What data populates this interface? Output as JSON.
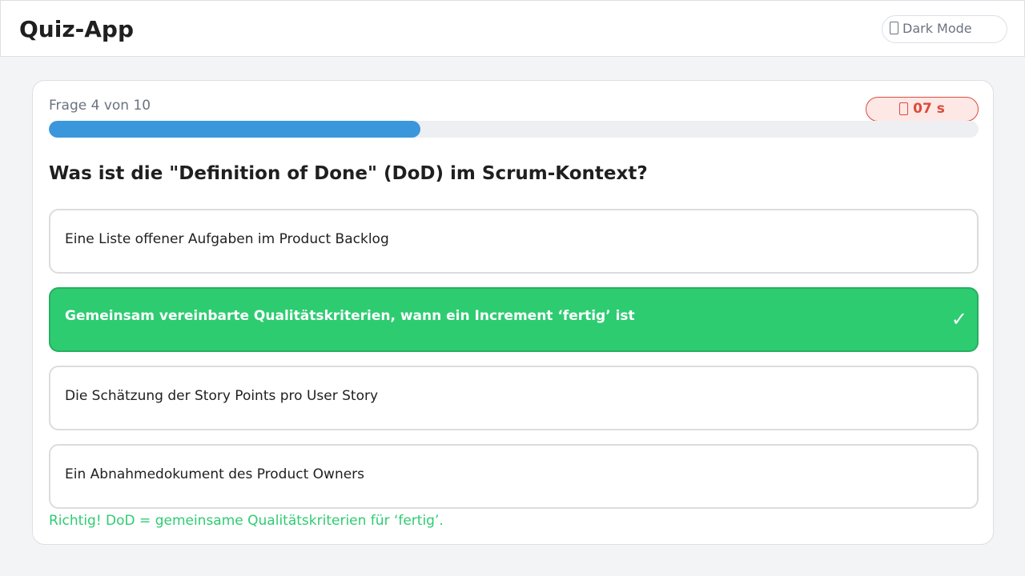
{
  "app": {
    "title": "Quiz-App"
  },
  "header": {
    "dark_mode_label": "Dark Mode",
    "dark_mode_icon": "moon-icon"
  },
  "quiz": {
    "progress_text": "Frage 4 von 10",
    "progress_fraction": 0.4,
    "timer_text": "07 s",
    "timer_icon": "stopwatch-icon",
    "question": "Was ist die \"Definition of Done\" (DoD) im Scrum-Kontext?",
    "answers": [
      {
        "text": "Eine Liste offener Aufgaben im Product Backlog",
        "state": "neutral"
      },
      {
        "text": "Gemeinsam vereinbarte Qualitätskriterien, wann ein Increment ‘fertig’ ist",
        "state": "correct",
        "mark": "✓"
      },
      {
        "text": "Die Schätzung der Story Points pro User Story",
        "state": "neutral"
      },
      {
        "text": "Ein Abnahmedokument des Product Owners",
        "state": "neutral"
      }
    ],
    "feedback": "Richtig! DoD = gemeinsame Qualitätskriterien für ‘fertig’."
  },
  "colors": {
    "accent": "#3b97dc",
    "correct": "#2ecc71",
    "timer": "#dc4a3c",
    "background": "#f3f4f6"
  }
}
